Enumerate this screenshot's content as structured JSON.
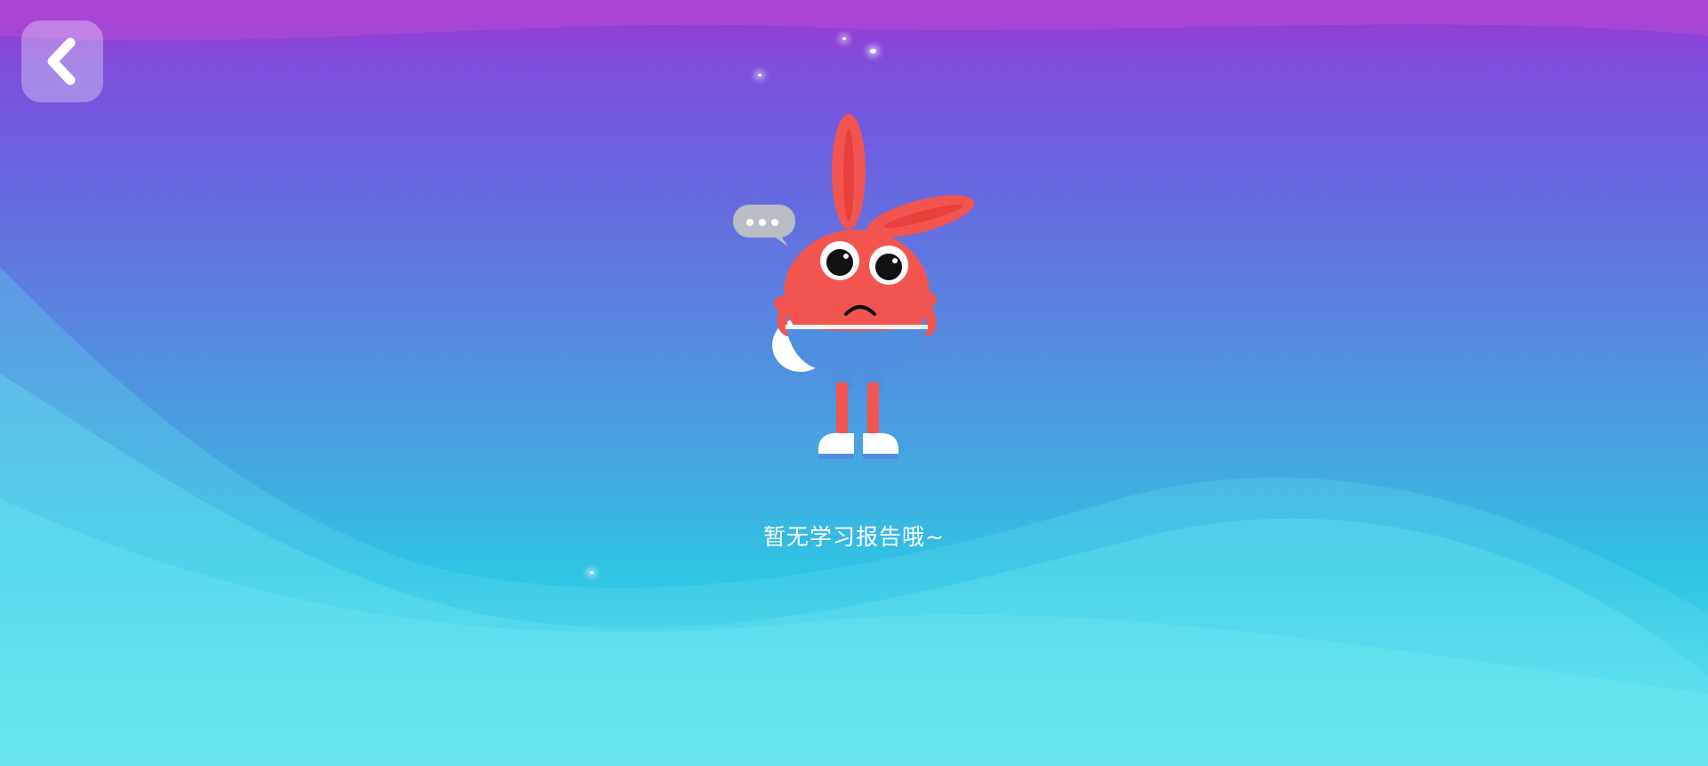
{
  "screen": {
    "back_button": {
      "icon": "chevron-left-icon"
    },
    "empty_state": {
      "illustration": "sad-rabbit-mascot",
      "message": "暂无学习报告哦~"
    }
  },
  "colors": {
    "top": "#a034d0",
    "middle": "#5a82e0",
    "bottom": "#63e6ee",
    "mascot_body": "#f2554f",
    "mascot_pants": "#4f8fe0"
  }
}
